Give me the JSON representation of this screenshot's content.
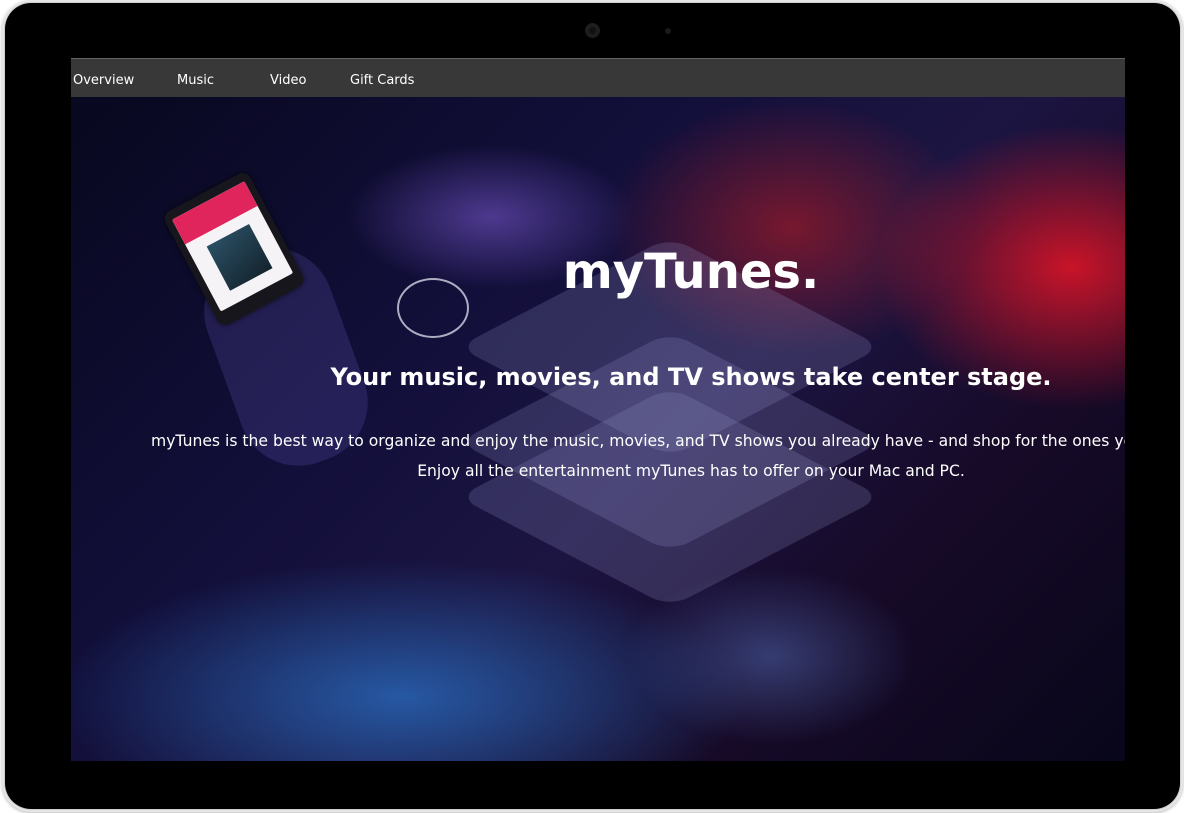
{
  "nav": {
    "items": [
      {
        "label": "Overview"
      },
      {
        "label": "Music"
      },
      {
        "label": "Video"
      },
      {
        "label": "Gift Cards"
      }
    ]
  },
  "hero": {
    "title": "myTunes.",
    "subtitle": "Your music, movies, and TV shows take center stage.",
    "line1": "myTunes is the best way to organize and enjoy the music, movies, and TV shows you already have - and shop for the ones you want to get.",
    "line2": "Enjoy all the entertainment myTunes has to offer on your Mac and PC."
  },
  "colors": {
    "navbar": "#383838",
    "accent_red": "#d21428",
    "accent_blue": "#2864b4"
  },
  "icons": [
    "stack-logo-icon"
  ]
}
